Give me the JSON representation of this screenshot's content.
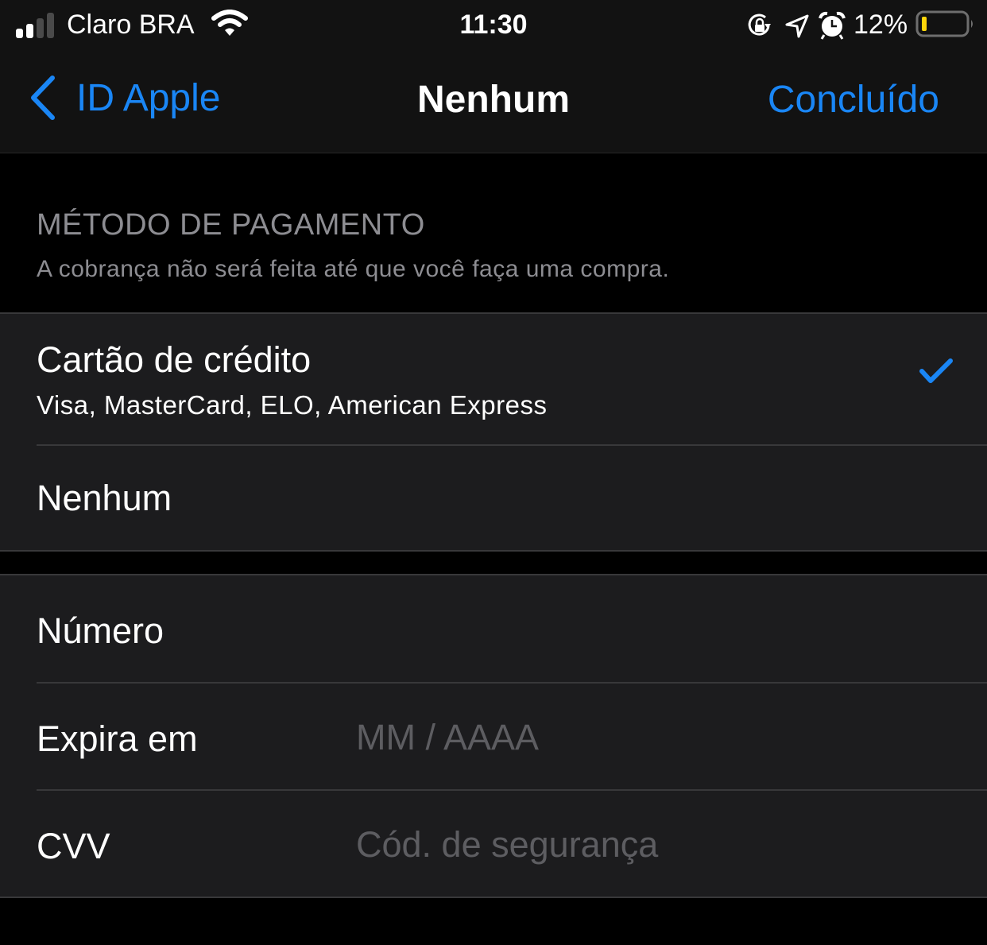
{
  "status_bar": {
    "carrier": "Claro BRA",
    "time": "11:30",
    "battery_percent": "12%",
    "battery_level": 0.12,
    "signal_bars": 2,
    "signal_bars_total": 4,
    "icons": [
      "signal-icon",
      "wifi-icon",
      "orientation-lock-icon",
      "location-icon",
      "alarm-icon",
      "battery-icon"
    ]
  },
  "nav": {
    "back_label": "ID Apple",
    "title": "Nenhum",
    "done_label": "Concluído"
  },
  "payment_section": {
    "header": "MÉTODO DE PAGAMENTO",
    "subtitle": "A cobrança não será feita até que você faça uma compra.",
    "options": [
      {
        "title": "Cartão de crédito",
        "subtitle": "Visa, MasterCard, ELO, American Express",
        "selected": true
      },
      {
        "title": "Nenhum",
        "selected": false
      }
    ]
  },
  "card_fields": [
    {
      "label": "Número",
      "value": "",
      "placeholder": ""
    },
    {
      "label": "Expira em",
      "value": "",
      "placeholder": "MM / AAAA"
    },
    {
      "label": "CVV",
      "value": "",
      "placeholder": "Cód. de segurança"
    }
  ],
  "colors": {
    "accent": "#1a86f5",
    "background": "#000000",
    "cell_background": "#1c1c1e",
    "secondary_text": "#8d8d92",
    "placeholder": "#5d5d61",
    "battery_low": "#ffd60a"
  }
}
